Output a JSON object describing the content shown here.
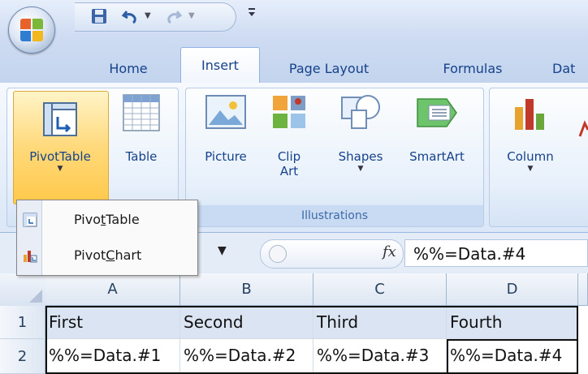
{
  "app": {
    "tabs": [
      {
        "label": "Home"
      },
      {
        "label": "Insert"
      },
      {
        "label": "Page Layout"
      },
      {
        "label": "Formulas"
      },
      {
        "label": "Dat"
      }
    ],
    "active_tab": "Insert"
  },
  "ribbon": {
    "groups": {
      "tables": {
        "pivottable_label": "PivotTable",
        "table_label": "Table"
      },
      "illustrations": {
        "label": "Illustrations",
        "picture_label": "Picture",
        "clipart_label_1": "Clip",
        "clipart_label_2": "Art",
        "shapes_label": "Shapes",
        "smartart_label": "SmartArt"
      },
      "charts": {
        "column_label": "Column"
      }
    }
  },
  "dropdown": {
    "items": [
      {
        "label_pre": "Pivo",
        "label_accel": "t",
        "label_post": "Table"
      },
      {
        "label_pre": "Pivot",
        "label_accel": "C",
        "label_post": "hart"
      }
    ]
  },
  "formula_bar": {
    "fx_label": "fx",
    "value": "%%=Data.#4"
  },
  "sheet": {
    "columns": [
      "A",
      "B",
      "C",
      "D"
    ],
    "rows": [
      {
        "number": "1",
        "cells": [
          "First",
          "Second",
          "Third",
          "Fourth"
        ]
      },
      {
        "number": "2",
        "cells": [
          "%%=Data.#1",
          "%%=Data.#2",
          "%%=Data.#3",
          "%%=Data.#4"
        ]
      }
    ]
  },
  "colors": {
    "ribbon_blue": "#15428b",
    "pivot_highlight": "#ffd97a",
    "header_fill": "#dbe4f2"
  }
}
